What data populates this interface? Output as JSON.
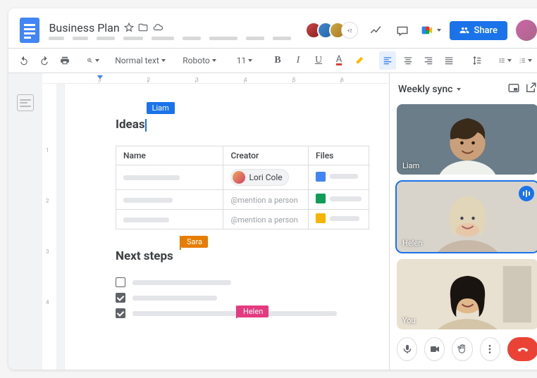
{
  "header": {
    "doc_title": "Business Plan",
    "share_label": "Share",
    "collaborator_count_label": "+2"
  },
  "toolbar": {
    "style_label": "Normal text",
    "font_label": "Roboto",
    "font_size": "11"
  },
  "collaborators": {
    "liam": "Liam",
    "sara": "Sara",
    "helen": "Helen"
  },
  "doc": {
    "ideas_heading": "Ideas",
    "next_steps_heading": "Next steps",
    "table_headers": {
      "name": "Name",
      "creator": "Creator",
      "files": "Files"
    },
    "creator_chip": "Lori Cole",
    "mention_placeholder": "@mention a person"
  },
  "meet": {
    "title": "Weekly sync",
    "tiles": [
      {
        "name": "Liam"
      },
      {
        "name": "Helen"
      },
      {
        "name": "You"
      }
    ]
  },
  "ruler": {
    "marks": [
      "1",
      "2",
      "3",
      "4",
      "5",
      "6"
    ],
    "vmarks": [
      "1",
      "2",
      "3",
      "4"
    ]
  }
}
